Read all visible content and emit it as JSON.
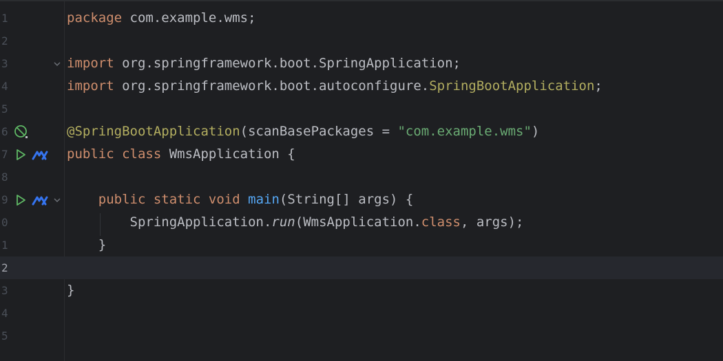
{
  "editor": {
    "lines": [
      {
        "num": "1",
        "tokens": [
          {
            "t": "package",
            "c": "kw"
          },
          {
            "t": " com.example.wms;"
          }
        ]
      },
      {
        "num": "2",
        "tokens": []
      },
      {
        "num": "3",
        "fold": true,
        "tokens": [
          {
            "t": "import",
            "c": "kw"
          },
          {
            "t": " org.springframework.boot.SpringApplication;"
          }
        ]
      },
      {
        "num": "4",
        "tokens": [
          {
            "t": "import",
            "c": "kw"
          },
          {
            "t": " org.springframework.boot.autoconfigure."
          },
          {
            "t": "SpringBootApplication",
            "c": "ann"
          },
          {
            "t": ";"
          }
        ]
      },
      {
        "num": "5",
        "tokens": []
      },
      {
        "num": "6",
        "gutter": "spring-bean-icon",
        "tokens": [
          {
            "t": "@SpringBootApplication",
            "c": "ann"
          },
          {
            "t": "(scanBasePackages = "
          },
          {
            "t": "\"com.example.wms\"",
            "c": "str"
          },
          {
            "t": ")"
          }
        ]
      },
      {
        "num": "7",
        "gutter": "run",
        "tokens": [
          {
            "t": "public class",
            "c": "kw"
          },
          {
            "t": " WmsApplication {"
          }
        ]
      },
      {
        "num": "8",
        "tokens": []
      },
      {
        "num": "9",
        "gutter": "run",
        "fold": true,
        "tokens": [
          {
            "t": "    "
          },
          {
            "t": "public static void",
            "c": "kw"
          },
          {
            "t": " "
          },
          {
            "t": "main",
            "c": "fn"
          },
          {
            "t": "(String[] args) {"
          }
        ]
      },
      {
        "num": "0",
        "tokens": [
          {
            "t": "        SpringApplication."
          },
          {
            "t": "run",
            "c": "it"
          },
          {
            "t": "(WmsApplication."
          },
          {
            "t": "class",
            "c": "kw"
          },
          {
            "t": ", args);"
          }
        ]
      },
      {
        "num": "1",
        "tokens": [
          {
            "t": "    }"
          }
        ]
      },
      {
        "num": "2",
        "current": true,
        "tokens": []
      },
      {
        "num": "3",
        "tokens": [
          {
            "t": "}"
          }
        ]
      },
      {
        "num": "4",
        "tokens": []
      },
      {
        "num": "5",
        "tokens": []
      }
    ]
  },
  "colors": {
    "background": "#1e1f22",
    "keyword": "#cf8e6d",
    "annotation": "#b3ae60",
    "string": "#6aab73",
    "function": "#56a8f5",
    "text": "#bcbec4",
    "run_icon": "#5fb865",
    "profiler_icon": "#3574f0"
  }
}
